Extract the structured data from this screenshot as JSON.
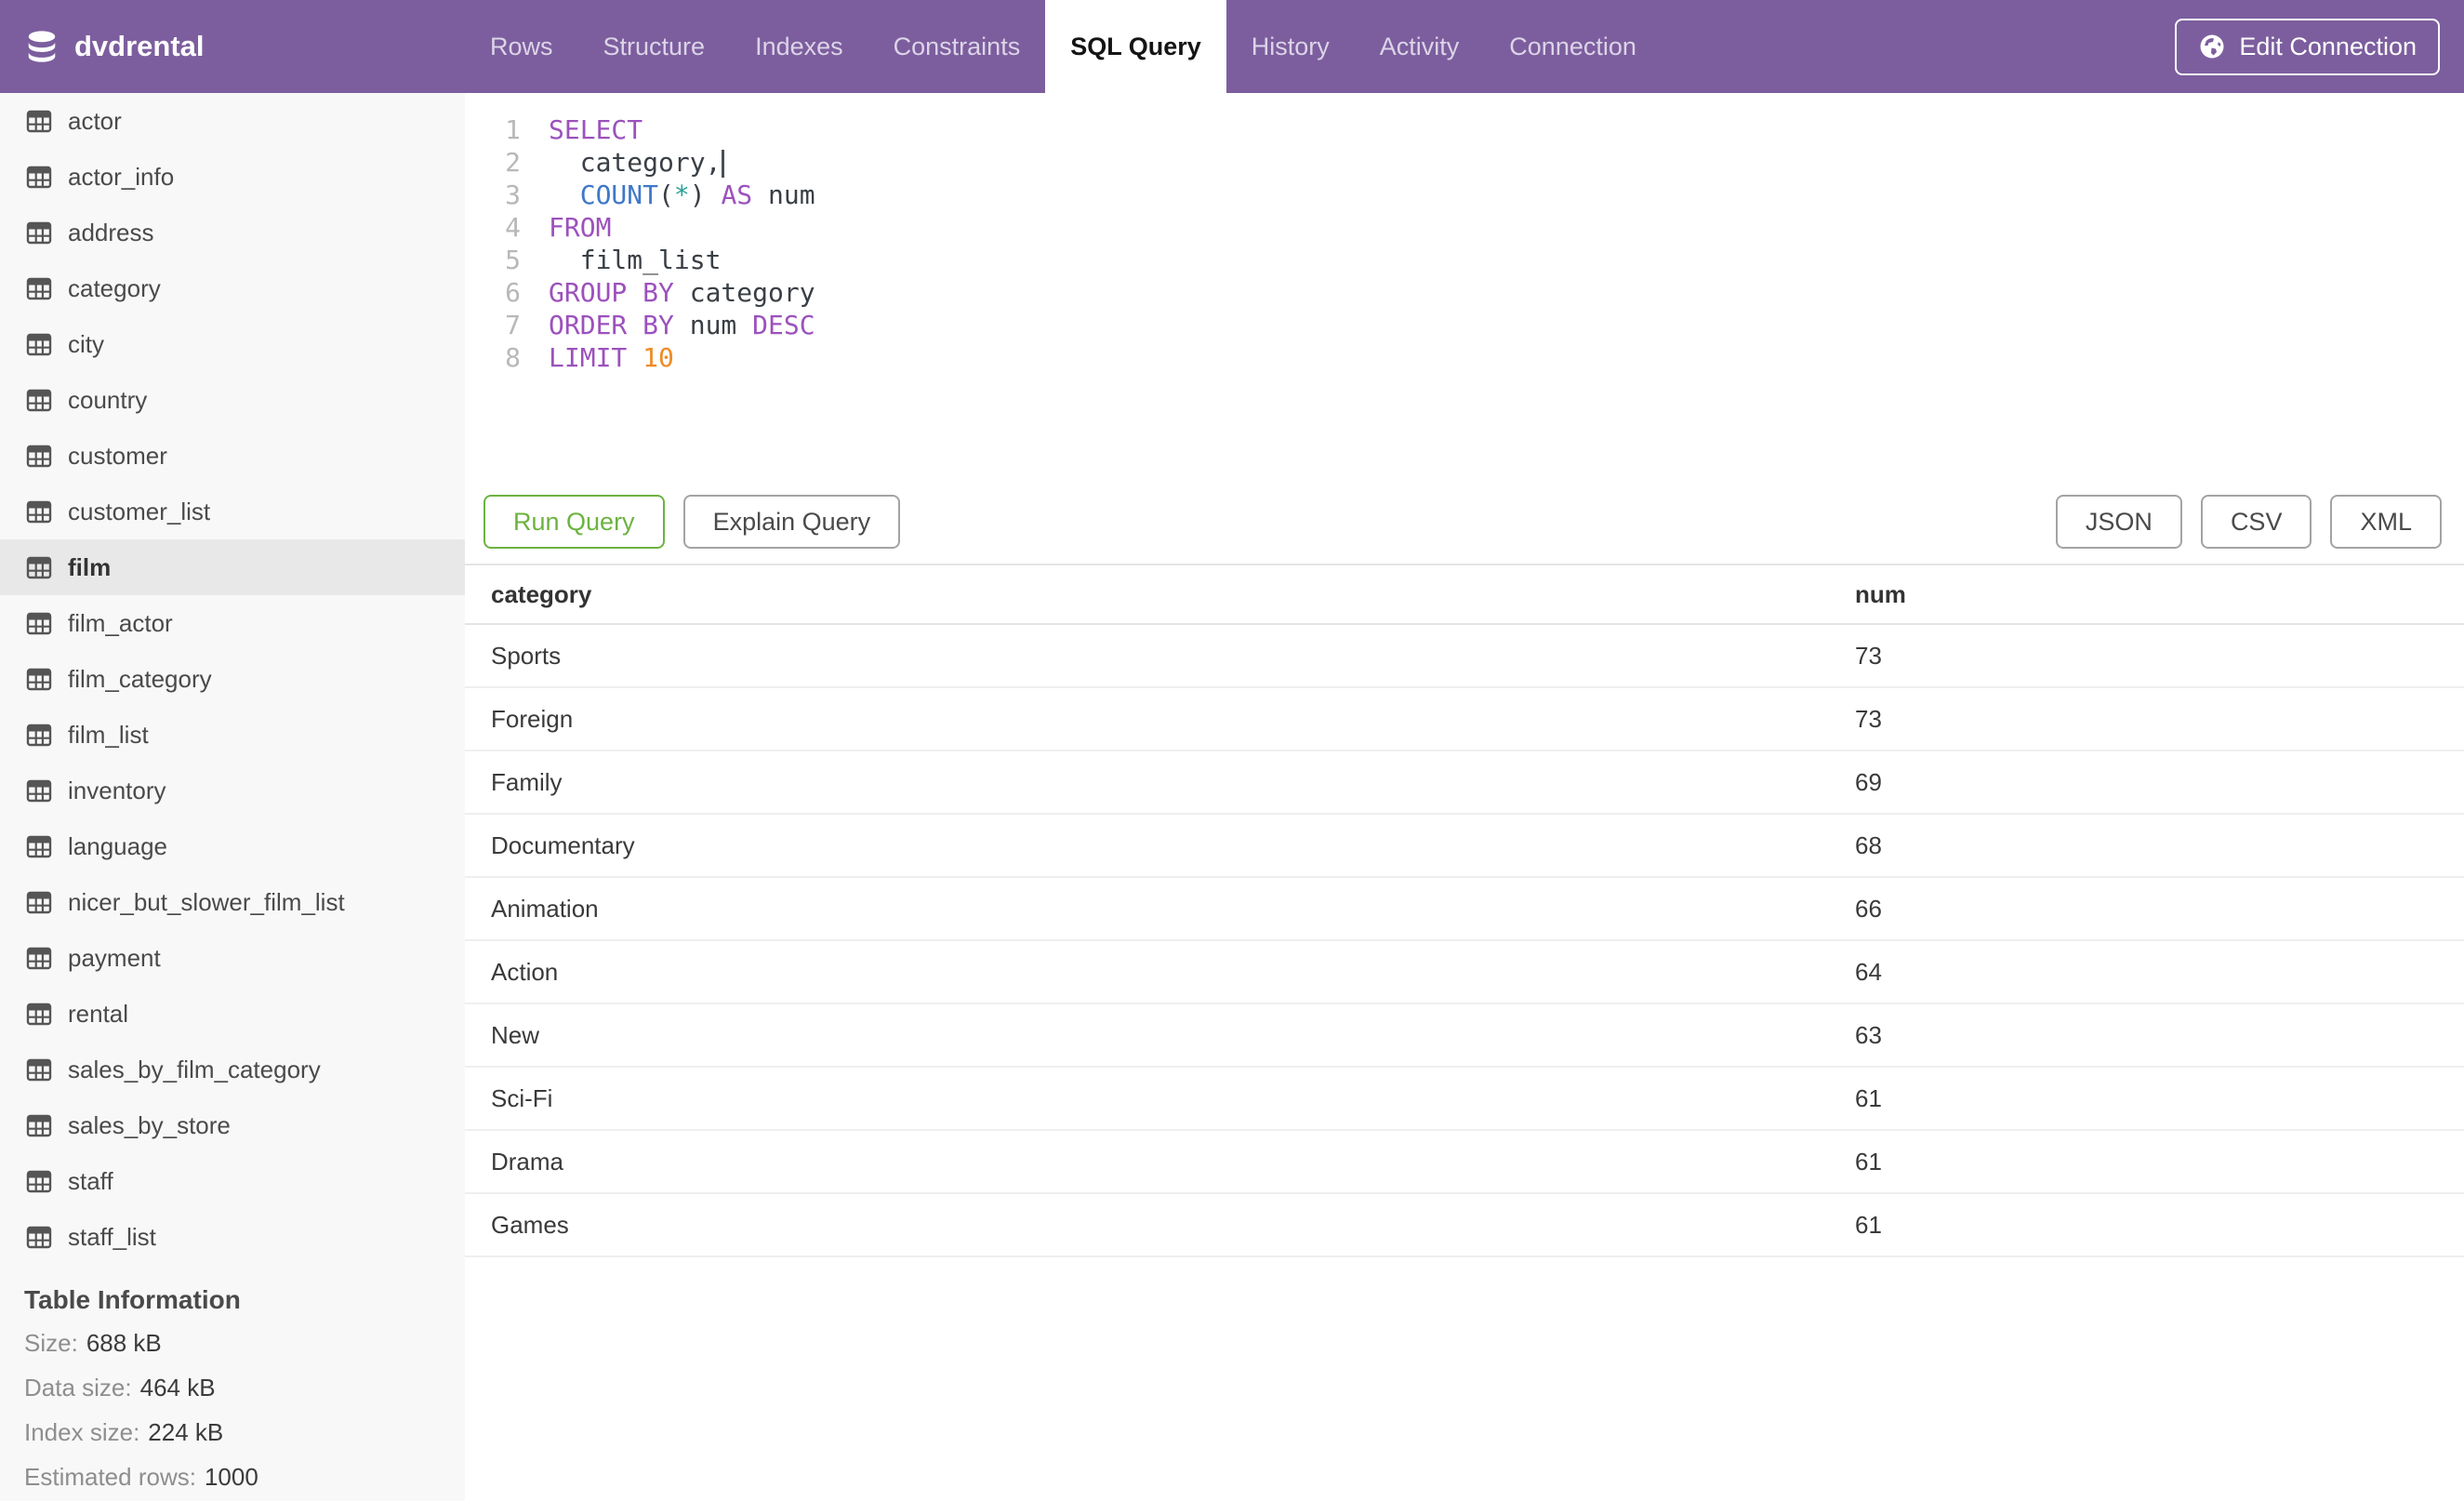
{
  "header": {
    "db_name": "dvdrental",
    "tabs": [
      {
        "label": "Rows",
        "active": false
      },
      {
        "label": "Structure",
        "active": false
      },
      {
        "label": "Indexes",
        "active": false
      },
      {
        "label": "Constraints",
        "active": false
      },
      {
        "label": "SQL Query",
        "active": true
      },
      {
        "label": "History",
        "active": false
      },
      {
        "label": "Activity",
        "active": false
      },
      {
        "label": "Connection",
        "active": false
      }
    ],
    "edit_connection_label": "Edit Connection"
  },
  "sidebar": {
    "tables": [
      "actor",
      "actor_info",
      "address",
      "category",
      "city",
      "country",
      "customer",
      "customer_list",
      "film",
      "film_actor",
      "film_category",
      "film_list",
      "inventory",
      "language",
      "nicer_but_slower_film_list",
      "payment",
      "rental",
      "sales_by_film_category",
      "sales_by_store",
      "staff",
      "staff_list"
    ],
    "selected_table": "film",
    "info": {
      "heading": "Table Information",
      "rows": [
        {
          "label": "Size:",
          "value": "688 kB"
        },
        {
          "label": "Data size:",
          "value": "464 kB"
        },
        {
          "label": "Index size:",
          "value": "224 kB"
        },
        {
          "label": "Estimated rows:",
          "value": "1000"
        }
      ]
    }
  },
  "editor": {
    "lines": [
      {
        "num": "1",
        "tokens": [
          {
            "type": "keyword",
            "text": "SELECT"
          }
        ]
      },
      {
        "num": "2",
        "tokens": [
          {
            "type": "plain",
            "text": "  category,"
          },
          {
            "type": "caret"
          }
        ]
      },
      {
        "num": "3",
        "tokens": [
          {
            "type": "plain",
            "text": "  "
          },
          {
            "type": "function",
            "text": "COUNT"
          },
          {
            "type": "plain",
            "text": "("
          },
          {
            "type": "operator",
            "text": "*"
          },
          {
            "type": "plain",
            "text": ") "
          },
          {
            "type": "keyword",
            "text": "AS"
          },
          {
            "type": "plain",
            "text": " num"
          }
        ]
      },
      {
        "num": "4",
        "tokens": [
          {
            "type": "keyword",
            "text": "FROM"
          }
        ]
      },
      {
        "num": "5",
        "tokens": [
          {
            "type": "plain",
            "text": "  film_list"
          }
        ]
      },
      {
        "num": "6",
        "tokens": [
          {
            "type": "keyword",
            "text": "GROUP BY"
          },
          {
            "type": "plain",
            "text": " category"
          }
        ]
      },
      {
        "num": "7",
        "tokens": [
          {
            "type": "keyword",
            "text": "ORDER BY"
          },
          {
            "type": "plain",
            "text": " num "
          },
          {
            "type": "keyword",
            "text": "DESC"
          }
        ]
      },
      {
        "num": "8",
        "tokens": [
          {
            "type": "keyword",
            "text": "LIMIT"
          },
          {
            "type": "plain",
            "text": " "
          },
          {
            "type": "number",
            "text": "10"
          }
        ]
      }
    ]
  },
  "toolbar": {
    "run_label": "Run Query",
    "explain_label": "Explain Query",
    "export_buttons": [
      "JSON",
      "CSV",
      "XML"
    ]
  },
  "results": {
    "columns": [
      "category",
      "num"
    ],
    "rows": [
      [
        "Sports",
        "73"
      ],
      [
        "Foreign",
        "73"
      ],
      [
        "Family",
        "69"
      ],
      [
        "Documentary",
        "68"
      ],
      [
        "Animation",
        "66"
      ],
      [
        "Action",
        "64"
      ],
      [
        "New",
        "63"
      ],
      [
        "Sci-Fi",
        "61"
      ],
      [
        "Drama",
        "61"
      ],
      [
        "Games",
        "61"
      ]
    ]
  },
  "colors": {
    "header_bg": "#7C5E9E",
    "run_green": "#6CB340",
    "keyword_purple": "#9C51BD",
    "function_blue": "#3E78C8",
    "operator_teal": "#2AA198",
    "number_orange": "#F08A24",
    "sidebar_selected_bg": "#E8E8E8"
  }
}
